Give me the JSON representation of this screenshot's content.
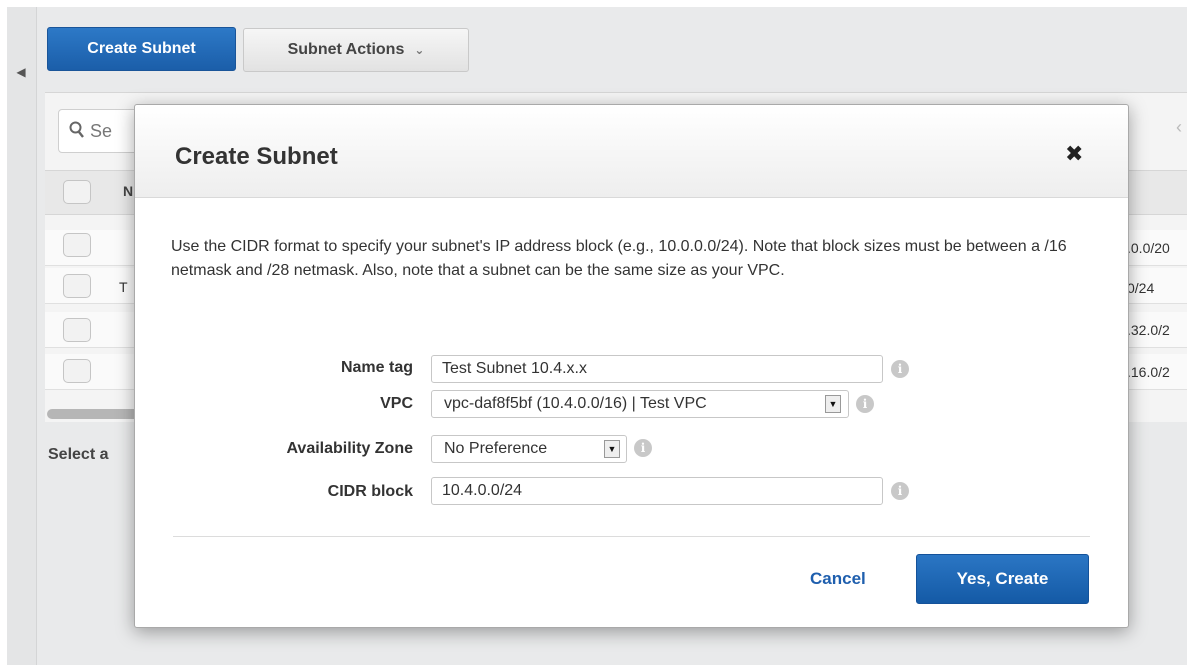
{
  "toolbar": {
    "create_subnet_label": "Create Subnet",
    "subnet_actions_label": "Subnet Actions",
    "subnet_actions_icon": "chevron-down-icon"
  },
  "search": {
    "visible_text": "Se"
  },
  "table": {
    "header_partial": "N",
    "rows": [
      {
        "left": "",
        "right": ".0.0/20"
      },
      {
        "left": "T",
        "right": "0/24"
      },
      {
        "left": "",
        "right": ".32.0/2"
      },
      {
        "left": "",
        "right": ".16.0/2"
      }
    ]
  },
  "details": {
    "select_partial": "Select a"
  },
  "modal": {
    "title": "Create Subnet",
    "close_glyph": "✖",
    "description": "Use the CIDR format to specify your subnet's IP address block (e.g., 10.0.0.0/24). Note that block sizes must be between a /16 netmask and /28 netmask. Also, note that a subnet can be the same size as your VPC.",
    "fields": {
      "name_tag": {
        "label": "Name tag",
        "value": "Test Subnet 10.4.x.x"
      },
      "vpc": {
        "label": "VPC",
        "value": "vpc-daf8f5bf (10.4.0.0/16) | Test VPC"
      },
      "availability_zone": {
        "label": "Availability Zone",
        "value": "No Preference"
      },
      "cidr_block": {
        "label": "CIDR block",
        "value": "10.4.0.0/24"
      }
    },
    "cancel_label": "Cancel",
    "confirm_label": "Yes, Create"
  },
  "colors": {
    "primary_button": "#1f66b6",
    "link_blue": "#1f5fae",
    "info_icon": "#c8c8c8"
  }
}
